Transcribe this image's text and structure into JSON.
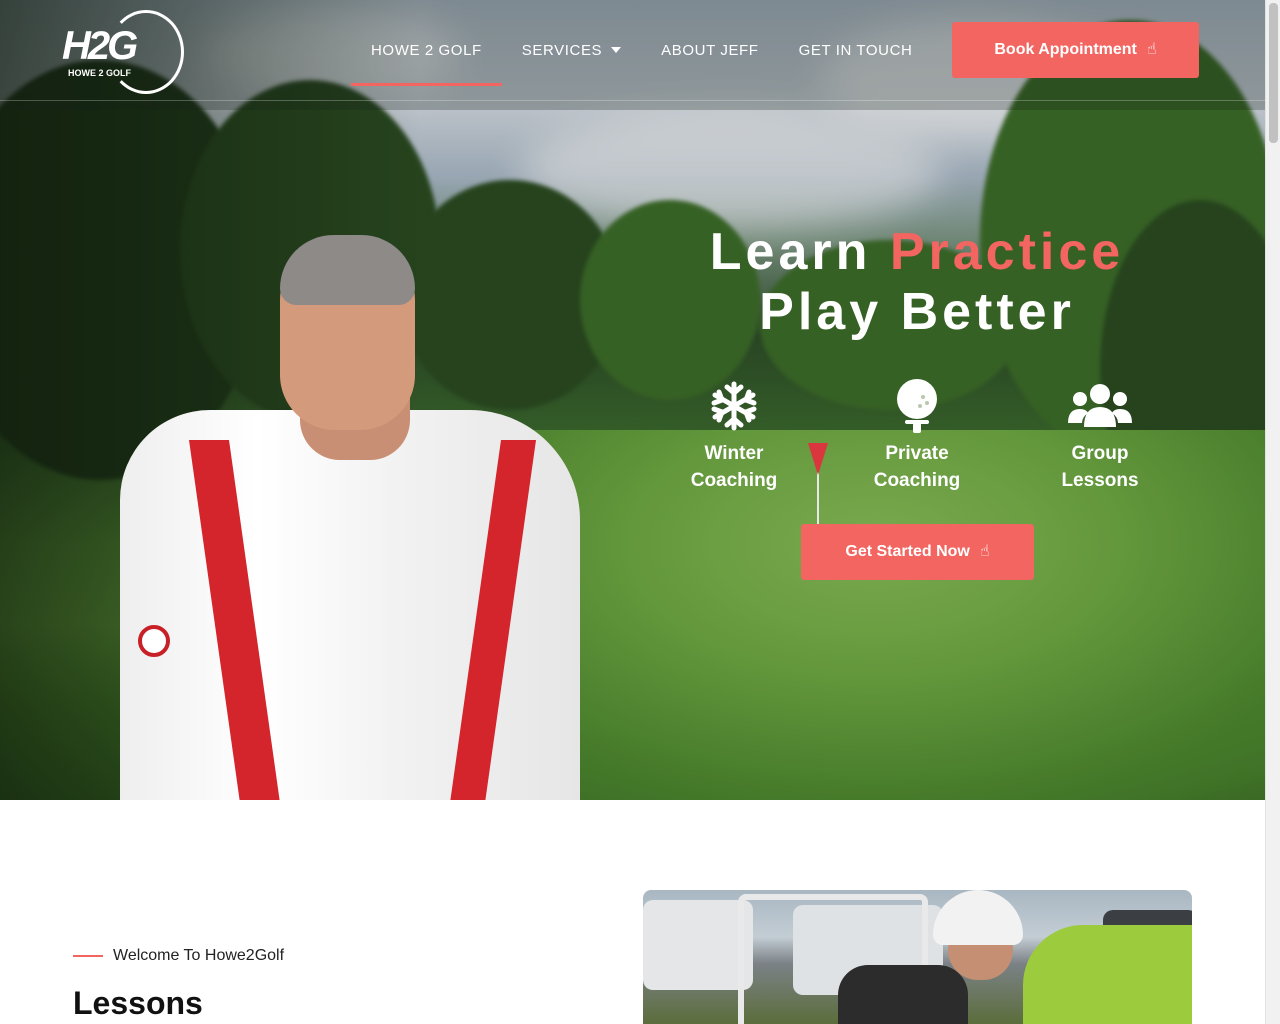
{
  "colors": {
    "accent": "#f26560",
    "white": "#ffffff"
  },
  "logo": {
    "mark": "H2G",
    "sub": "HOWE 2 GOLF"
  },
  "nav": {
    "items": [
      {
        "label": "HOWE 2 GOLF",
        "active": true
      },
      {
        "label": "SERVICES",
        "active": false,
        "has_dropdown": true
      },
      {
        "label": "ABOUT JEFF",
        "active": false
      },
      {
        "label": "GET IN TOUCH",
        "active": false
      }
    ],
    "cta": "Book Appointment"
  },
  "hero": {
    "headline_1": "Learn",
    "headline_accent": "Practice",
    "headline_2": "Play Better",
    "features": [
      {
        "icon": "snowflake-icon",
        "line1": "Winter",
        "line2": "Coaching"
      },
      {
        "icon": "golf-ball-on-tee-icon",
        "line1": "Private",
        "line2": "Coaching"
      },
      {
        "icon": "users-icon",
        "line1": "Group",
        "line2": "Lessons"
      }
    ],
    "cta": "Get Started Now"
  },
  "section": {
    "eyebrow": "Welcome To Howe2Golf",
    "title": "Lessons"
  }
}
